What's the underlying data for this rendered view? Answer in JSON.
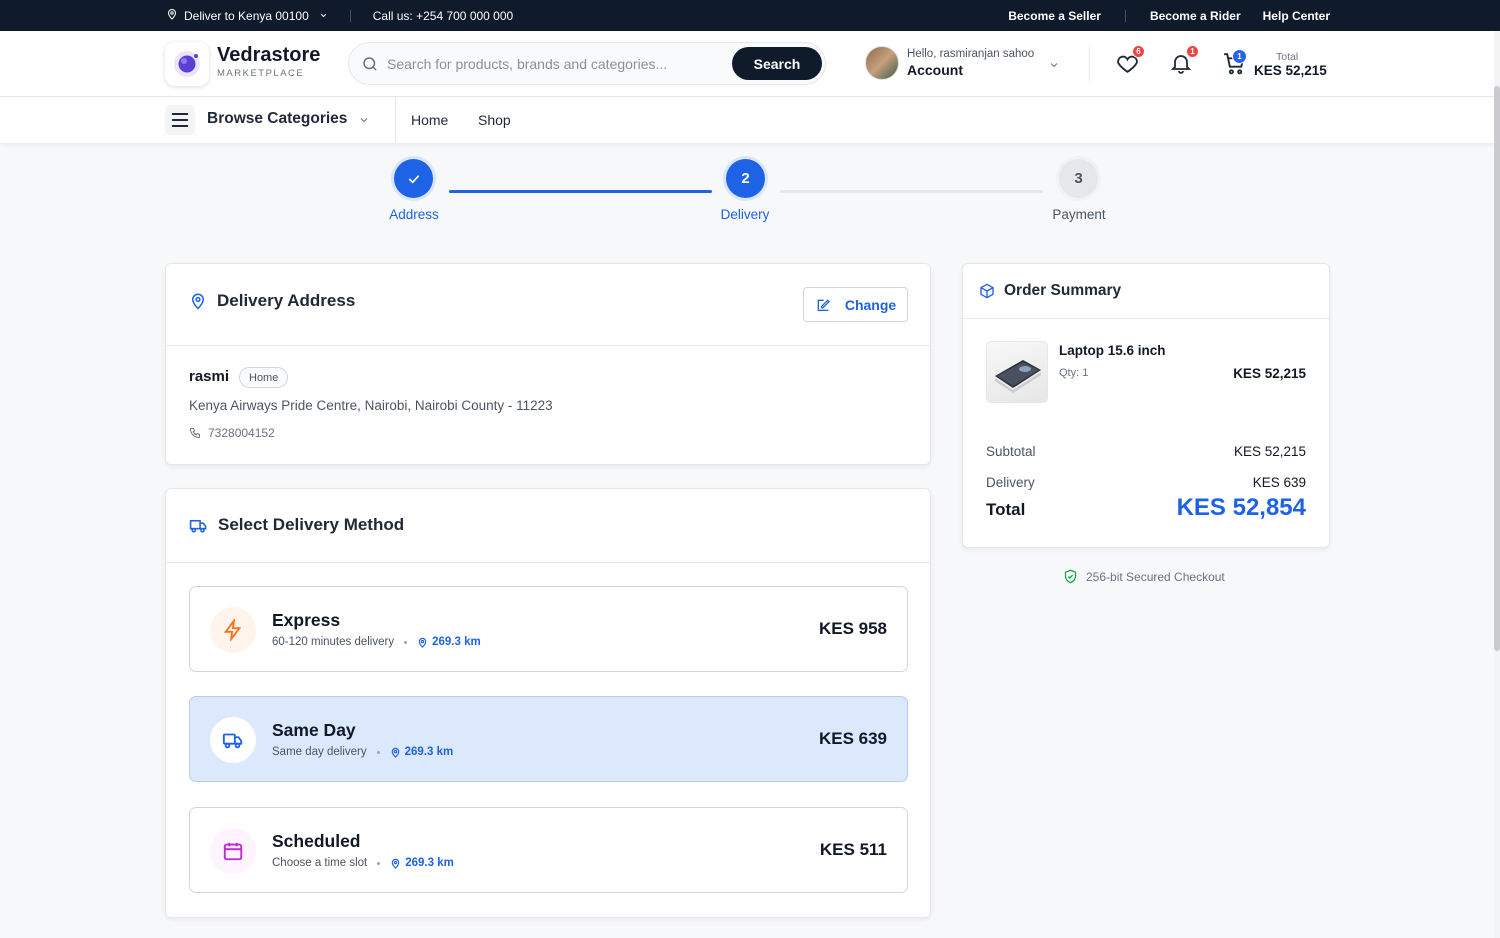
{
  "topbar": {
    "deliver_to": "Deliver to Kenya 00100",
    "call_us": "Call us: +254 700 000 000",
    "links": [
      "Become a Seller",
      "Become a Rider",
      "Help Center"
    ]
  },
  "header": {
    "brand_name": "Vedrastore",
    "brand_tag": "MARKETPLACE",
    "search_placeholder": "Search for products, brands and categories...",
    "search_button": "Search",
    "greeting": "Hello, rasmiranjan sahoo",
    "account_label": "Account",
    "wishlist_count": "6",
    "notification_count": "1",
    "cart_count": "1",
    "cart_total_label": "Total",
    "cart_total_value": "KES 52,215"
  },
  "nav": {
    "browse_label": "Browse Categories",
    "links": [
      "Home",
      "Shop"
    ]
  },
  "stepper": {
    "steps": [
      {
        "label": "Address",
        "state": "done",
        "number": ""
      },
      {
        "label": "Delivery",
        "state": "active",
        "number": "2"
      },
      {
        "label": "Payment",
        "state": "todo",
        "number": "3"
      }
    ]
  },
  "address": {
    "title": "Delivery Address",
    "change_label": "Change",
    "name": "rasmi",
    "tag": "Home",
    "line": "Kenya Airways Pride Centre, Nairobi, Nairobi County - 11223",
    "phone": "7328004152"
  },
  "delivery": {
    "title": "Select Delivery Method",
    "methods": [
      {
        "name": "Express",
        "desc": "60-120 minutes delivery",
        "distance": "269.3 km",
        "price": "KES 958",
        "icon": "bolt-icon",
        "selected": false
      },
      {
        "name": "Same Day",
        "desc": "Same day delivery",
        "distance": "269.3 km",
        "price": "KES 639",
        "icon": "truck-icon",
        "selected": true
      },
      {
        "name": "Scheduled",
        "desc": "Choose a time slot",
        "distance": "269.3 km",
        "price": "KES 511",
        "icon": "calendar-icon",
        "selected": false
      }
    ]
  },
  "summary": {
    "title": "Order Summary",
    "product_name": "Laptop 15.6 inch",
    "product_qty": "Qty: 1",
    "product_price": "KES 52,215",
    "subtotal_label": "Subtotal",
    "subtotal_value": "KES 52,215",
    "delivery_label": "Delivery",
    "delivery_value": "KES 639",
    "total_label": "Total",
    "total_value": "KES 52,854",
    "secure_text": "256-bit Secured Checkout"
  },
  "colors": {
    "accent": "#1e62e6",
    "dark": "#0f1a2a",
    "selected_bg": "#dce8fb",
    "express": "#f97316",
    "scheduled": "#c026d3"
  }
}
